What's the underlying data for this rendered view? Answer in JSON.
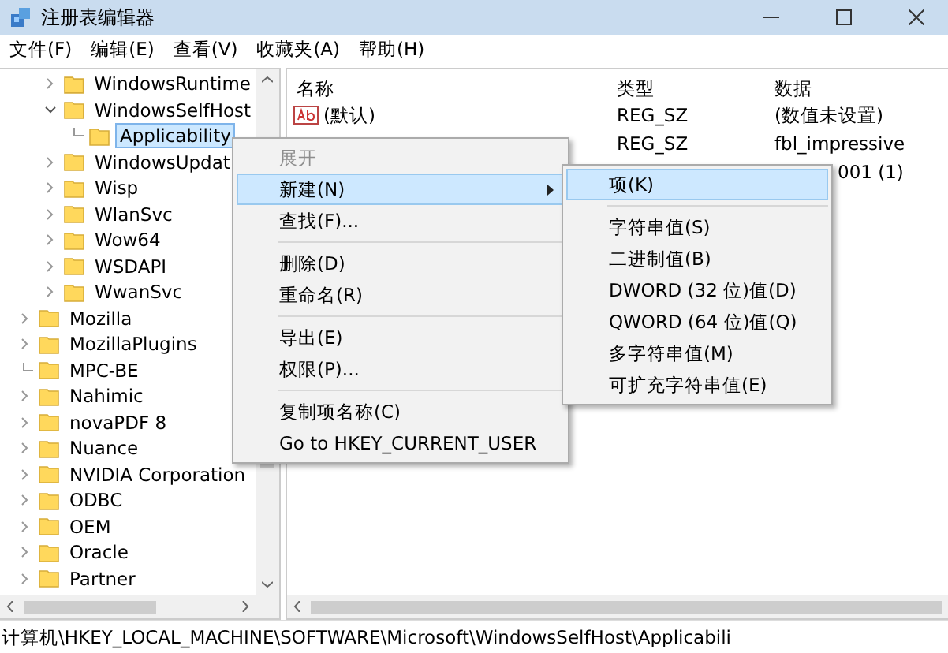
{
  "window": {
    "title": "注册表编辑器"
  },
  "menu": [
    "文件(F)",
    "编辑(E)",
    "查看(V)",
    "收藏夹(A)",
    "帮助(H)"
  ],
  "tree": {
    "items": [
      {
        "kind": "hidden",
        "children": [
          {
            "label": "WindowsRuntime",
            "kind": "branch",
            "expanded": false,
            "selected": false
          },
          {
            "label": "WindowsSelfHost",
            "kind": "branch",
            "expanded": true,
            "selected": false,
            "children": [
              {
                "label": "Applicability",
                "kind": "leaf",
                "selected": true
              }
            ]
          },
          {
            "label": "WindowsUpdat",
            "kind": "branch",
            "expanded": false,
            "selected": false
          },
          {
            "label": "Wisp",
            "kind": "branch",
            "expanded": false,
            "selected": false
          },
          {
            "label": "WlanSvc",
            "kind": "branch",
            "expanded": false,
            "selected": false
          },
          {
            "label": "Wow64",
            "kind": "branch",
            "expanded": false,
            "selected": false
          },
          {
            "label": "WSDAPI",
            "kind": "branch",
            "expanded": false,
            "selected": false
          },
          {
            "label": "WwanSvc",
            "kind": "branch",
            "expanded": false,
            "selected": false
          }
        ]
      },
      {
        "label": "Mozilla",
        "kind": "branch",
        "expanded": false,
        "selected": false
      },
      {
        "label": "MozillaPlugins",
        "kind": "branch",
        "expanded": false,
        "selected": false
      },
      {
        "label": "MPC-BE",
        "kind": "leaf",
        "selected": false
      },
      {
        "label": "Nahimic",
        "kind": "branch",
        "expanded": false,
        "selected": false
      },
      {
        "label": "novaPDF 8",
        "kind": "branch",
        "expanded": false,
        "selected": false
      },
      {
        "label": "Nuance",
        "kind": "branch",
        "expanded": false,
        "selected": false
      },
      {
        "label": "NVIDIA Corporation",
        "kind": "branch",
        "expanded": false,
        "selected": false
      },
      {
        "label": "ODBC",
        "kind": "branch",
        "expanded": false,
        "selected": false
      },
      {
        "label": "OEM",
        "kind": "branch",
        "expanded": false,
        "selected": false
      },
      {
        "label": "Oracle",
        "kind": "branch",
        "expanded": false,
        "selected": false
      },
      {
        "label": "Partner",
        "kind": "branch",
        "expanded": false,
        "selected": false
      }
    ]
  },
  "values": {
    "columns": [
      "名称",
      "类型",
      "数据"
    ],
    "rows": [
      {
        "kind": "string",
        "name": "(默认)",
        "type": "REG_SZ",
        "data": "(数值未设置)"
      },
      {
        "type": "REG_SZ",
        "data": "fbl_impressive"
      },
      {
        "data": "001 (1)"
      }
    ]
  },
  "context_menu": {
    "items": [
      {
        "kind": "item",
        "label": "展开",
        "disabled": true,
        "selected": false
      },
      {
        "kind": "submenu",
        "label": "新建(N)",
        "disabled": false,
        "selected": true
      },
      {
        "kind": "item",
        "label": "查找(F)...",
        "disabled": false,
        "selected": false
      },
      {
        "kind": "separator"
      },
      {
        "kind": "item",
        "label": "删除(D)",
        "disabled": false,
        "selected": false
      },
      {
        "kind": "item",
        "label": "重命名(R)",
        "disabled": false,
        "selected": false
      },
      {
        "kind": "separator"
      },
      {
        "kind": "item",
        "label": "导出(E)",
        "disabled": false,
        "selected": false
      },
      {
        "kind": "item",
        "label": "权限(P)...",
        "disabled": false,
        "selected": false
      },
      {
        "kind": "separator"
      },
      {
        "kind": "item",
        "label": "复制项名称(C)",
        "disabled": false,
        "selected": false
      },
      {
        "kind": "item",
        "label": "Go to HKEY_CURRENT_USER",
        "disabled": false,
        "selected": false
      }
    ]
  },
  "submenu": {
    "items": [
      {
        "kind": "item",
        "label": "项(K)",
        "selected": true
      },
      {
        "kind": "separator"
      },
      {
        "kind": "item",
        "label": "字符串值(S)",
        "selected": false
      },
      {
        "kind": "item",
        "label": "二进制值(B)",
        "selected": false
      },
      {
        "kind": "item",
        "label": "DWORD (32 位)值(D)",
        "selected": false
      },
      {
        "kind": "item",
        "label": "QWORD (64 位)值(Q)",
        "selected": false
      },
      {
        "kind": "item",
        "label": "多字符串值(M)",
        "selected": false
      },
      {
        "kind": "item",
        "label": "可扩充字符串值(E)",
        "selected": false
      }
    ]
  },
  "status_bar": "计算机\\HKEY_LOCAL_MACHINE\\SOFTWARE\\Microsoft\\WindowsSelfHost\\Applicabili"
}
